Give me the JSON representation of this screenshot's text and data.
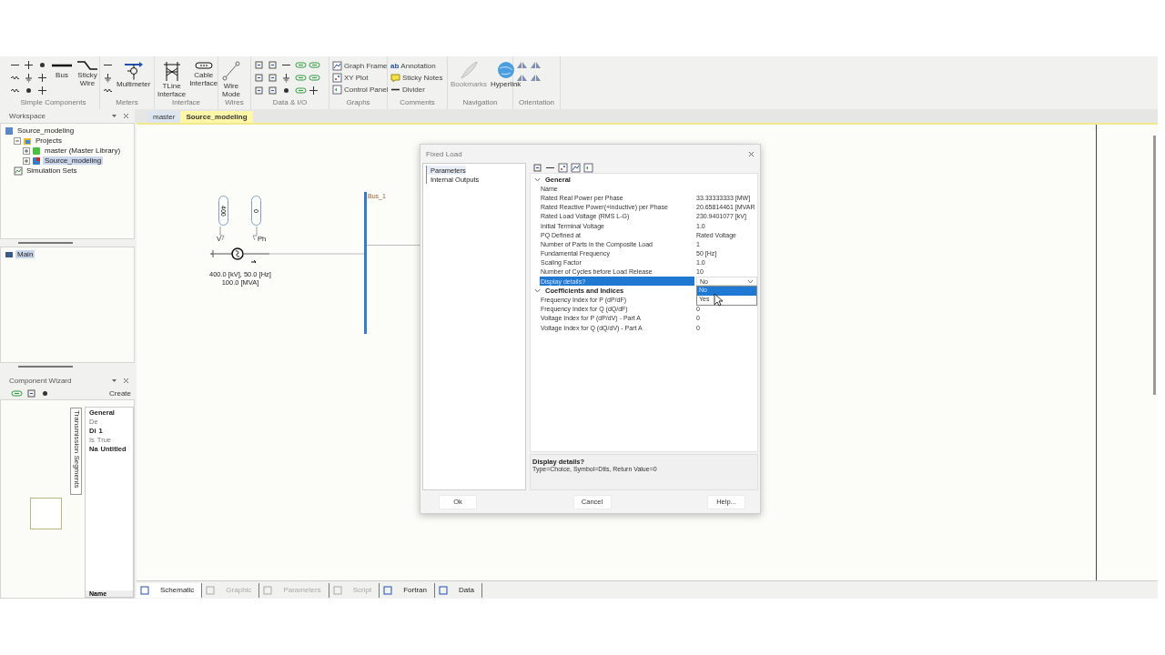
{
  "ribbon": {
    "groups": [
      {
        "label": "Simple Components",
        "kind": "simple",
        "items": [
          {
            "label": "Bus"
          },
          {
            "label": "Sticky Wire"
          }
        ]
      },
      {
        "label": "Meters",
        "kind": "meters",
        "items": [
          {
            "label": "Multimeter"
          }
        ]
      },
      {
        "label": "Interface",
        "kind": "plain",
        "items": [
          {
            "label": "TLine Interface"
          },
          {
            "label": "Cable Interface"
          }
        ]
      },
      {
        "label": "Wires",
        "kind": "plain",
        "items": [
          {
            "label": "Wire Mode"
          }
        ]
      },
      {
        "label": "Data & I/O",
        "kind": "data"
      },
      {
        "label": "Graphs",
        "kind": "list",
        "items": [
          {
            "label": "Graph Frame"
          },
          {
            "label": "XY Plot"
          },
          {
            "label": "Control Panel"
          }
        ]
      },
      {
        "label": "Comments",
        "kind": "list",
        "items": [
          {
            "label": "Annotation",
            "glyph": "ab"
          },
          {
            "label": "Sticky Notes"
          },
          {
            "label": "Divider"
          }
        ]
      },
      {
        "label": "Navigation",
        "kind": "plain",
        "items": [
          {
            "label": "Bookmarks",
            "disabled": true
          },
          {
            "label": "Hyperlink",
            "disabled": false
          }
        ]
      },
      {
        "label": "Orientation",
        "kind": "orient"
      }
    ]
  },
  "workspace": {
    "title": "Workspace",
    "tree": [
      {
        "label": "Source_modeling",
        "kind": "workspace",
        "selected": false,
        "children": [
          {
            "label": "Projects",
            "kind": "folder",
            "expanded": true,
            "selected": false,
            "children": [
              {
                "label": "master (Master Library)",
                "kind": "library",
                "expanded": false,
                "selected": false
              },
              {
                "label": "Source_modeling",
                "kind": "project",
                "expanded": false,
                "selected": true
              }
            ]
          },
          {
            "label": "Simulation Sets",
            "kind": "sets",
            "selected": false
          }
        ]
      }
    ]
  },
  "doc_tabs": [
    {
      "label": "master",
      "selected": false
    },
    {
      "label": "Source_modeling",
      "selected": true
    }
  ],
  "module_tree": [
    {
      "label": "Main",
      "selected": true
    }
  ],
  "component_wizard": {
    "title": "Component Wizard",
    "create": "Create",
    "side_tab": "Transmission Segments",
    "section": "General",
    "rows": [
      {
        "name": "De",
        "modified": false
      },
      {
        "name": "Di",
        "value": "1",
        "modified": true
      },
      {
        "name": "Is",
        "value": "True",
        "modified": false
      },
      {
        "name": "Na",
        "value": "Untitled",
        "modified": true
      }
    ],
    "footer": "Name"
  },
  "schematic": {
    "constants": [
      {
        "value": "400",
        "label": "V"
      },
      {
        "value": "0",
        "label": "Ph"
      }
    ],
    "source_rating": "400.0 [kV], 50.0 [Hz]",
    "source_power": "100.0 [MVA]",
    "bus": "Bus_1"
  },
  "dialog": {
    "title": "Fixed Load",
    "nav": [
      {
        "label": "Parameters",
        "selected": true
      },
      {
        "label": "Internal Outputs",
        "selected": false
      }
    ],
    "sections": [
      {
        "title": "General",
        "expanded": true,
        "rows": [
          {
            "name": "Name",
            "selected": false
          },
          {
            "name": "Rated Real Power per Phase",
            "value": "33.33333333 [MW]",
            "selected": false
          },
          {
            "name": "Rated Reactive Power(+inductive) per Phase",
            "value": "20.65814461 [MVAR",
            "selected": false
          },
          {
            "name": "Rated Load Voltage (RMS L-G)",
            "value": "230.9401077 [kV]",
            "selected": false
          },
          {
            "name": "Initial Terminal Voltage",
            "value": "1.0",
            "selected": false
          },
          {
            "name": "PQ Defined at",
            "value": "Rated Voltage",
            "selected": false
          },
          {
            "name": "Number of Parts in the Composite Load",
            "value": "1",
            "selected": false
          },
          {
            "name": "Fundamental Frequency",
            "value": "50 [Hz]",
            "selected": false
          },
          {
            "name": "Scaling Factor",
            "value": "1.0",
            "selected": false
          },
          {
            "name": "Number of Cycles before Load Release",
            "value": "10",
            "selected": false
          },
          {
            "name": "Display details?",
            "value": "No",
            "selected": true,
            "options": [
              {
                "label": "No",
                "selected": true
              },
              {
                "label": "Yes",
                "selected": false
              }
            ]
          }
        ]
      },
      {
        "title": "Coefficients and Indices",
        "expanded": true,
        "rows": [
          {
            "name": "Frequency Index for P (dP/dF)",
            "selected": false
          },
          {
            "name": "Frequency Index for Q (dQ/dF)",
            "value": "0",
            "selected": false
          },
          {
            "name": "Voltage Index for P (dP/dV) - Part A",
            "value": "0",
            "selected": false
          },
          {
            "name": "Voltage Index for Q (dQ/dV) - Part A",
            "value": "0",
            "selected": false
          }
        ]
      }
    ],
    "description": {
      "title": "Display details?",
      "text": "Type=Choice, Symbol=Dtls, Return Value=0"
    },
    "buttons": [
      "Ok",
      "Cancel",
      "Help..."
    ]
  },
  "bottom_tabs": [
    {
      "label": "Schematic",
      "selected": true,
      "disabled": false
    },
    {
      "label": "Graphic",
      "selected": false,
      "disabled": true
    },
    {
      "label": "Parameters",
      "selected": false,
      "disabled": true
    },
    {
      "label": "Script",
      "selected": false,
      "disabled": true
    },
    {
      "label": "Fortran",
      "selected": false,
      "disabled": false
    },
    {
      "label": "Data",
      "selected": false,
      "disabled": false
    }
  ]
}
